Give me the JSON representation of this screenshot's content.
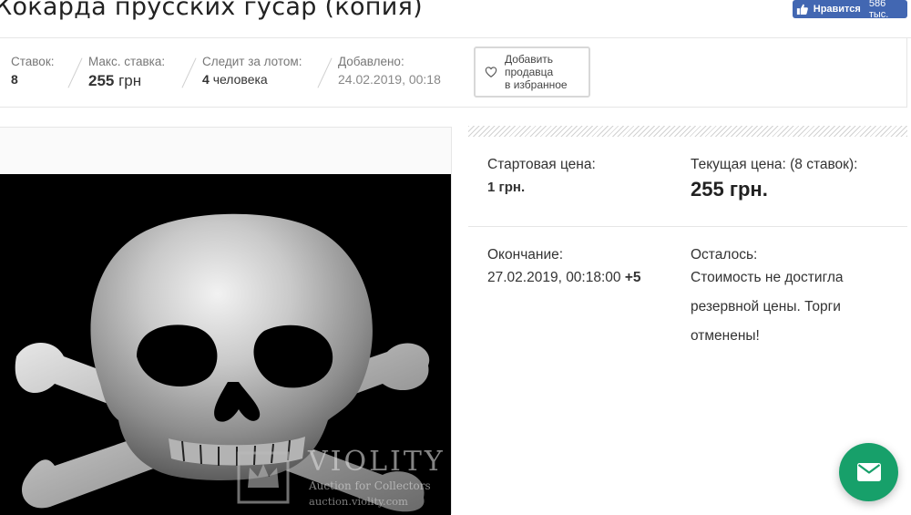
{
  "lot": {
    "title": "Кокарда прусских гусар (копия)"
  },
  "facebook": {
    "like_label": "Нравится",
    "like_count": "586 тыс."
  },
  "stats": {
    "bids_label": "Ставок:",
    "bids_value": "8",
    "max_bid_label": "Макс. ставка:",
    "max_bid_value": "255",
    "max_bid_currency": "грн",
    "watchers_label": "Следит за лотом:",
    "watchers_count": "4",
    "watchers_suffix": "человека",
    "added_label": "Добавлено:",
    "added_value": "24.02.2019, 00:18"
  },
  "favorite_seller_button": {
    "line1": "Добавить",
    "line2": "продавца",
    "line3": "в избранное"
  },
  "price_info": {
    "start_price_label": "Стартовая цена:",
    "start_price_value": "1 грн.",
    "current_price_label": "Текущая цена: (8 ставок):",
    "current_price_value": "255 грн.",
    "end_label": "Окончание:",
    "end_value": "27.02.2019, 00:18:00",
    "end_timezone": "+5",
    "remaining_label": "Осталось:",
    "remaining_value": "Стоимость не достигла резервной цены. Торги отменены!"
  },
  "watermark": {
    "brand": "VIOLITY",
    "tagline": "Auction for Collectors",
    "url": "auction.violity.com"
  },
  "colors": {
    "facebook_blue": "#4267b2",
    "fab_green": "#17a06a"
  },
  "icons": {
    "fb_thumb": "thumbs-up-icon",
    "favorite": "heart-icon",
    "fab": "envelope-icon",
    "watermark_logo": "crown-icon"
  }
}
